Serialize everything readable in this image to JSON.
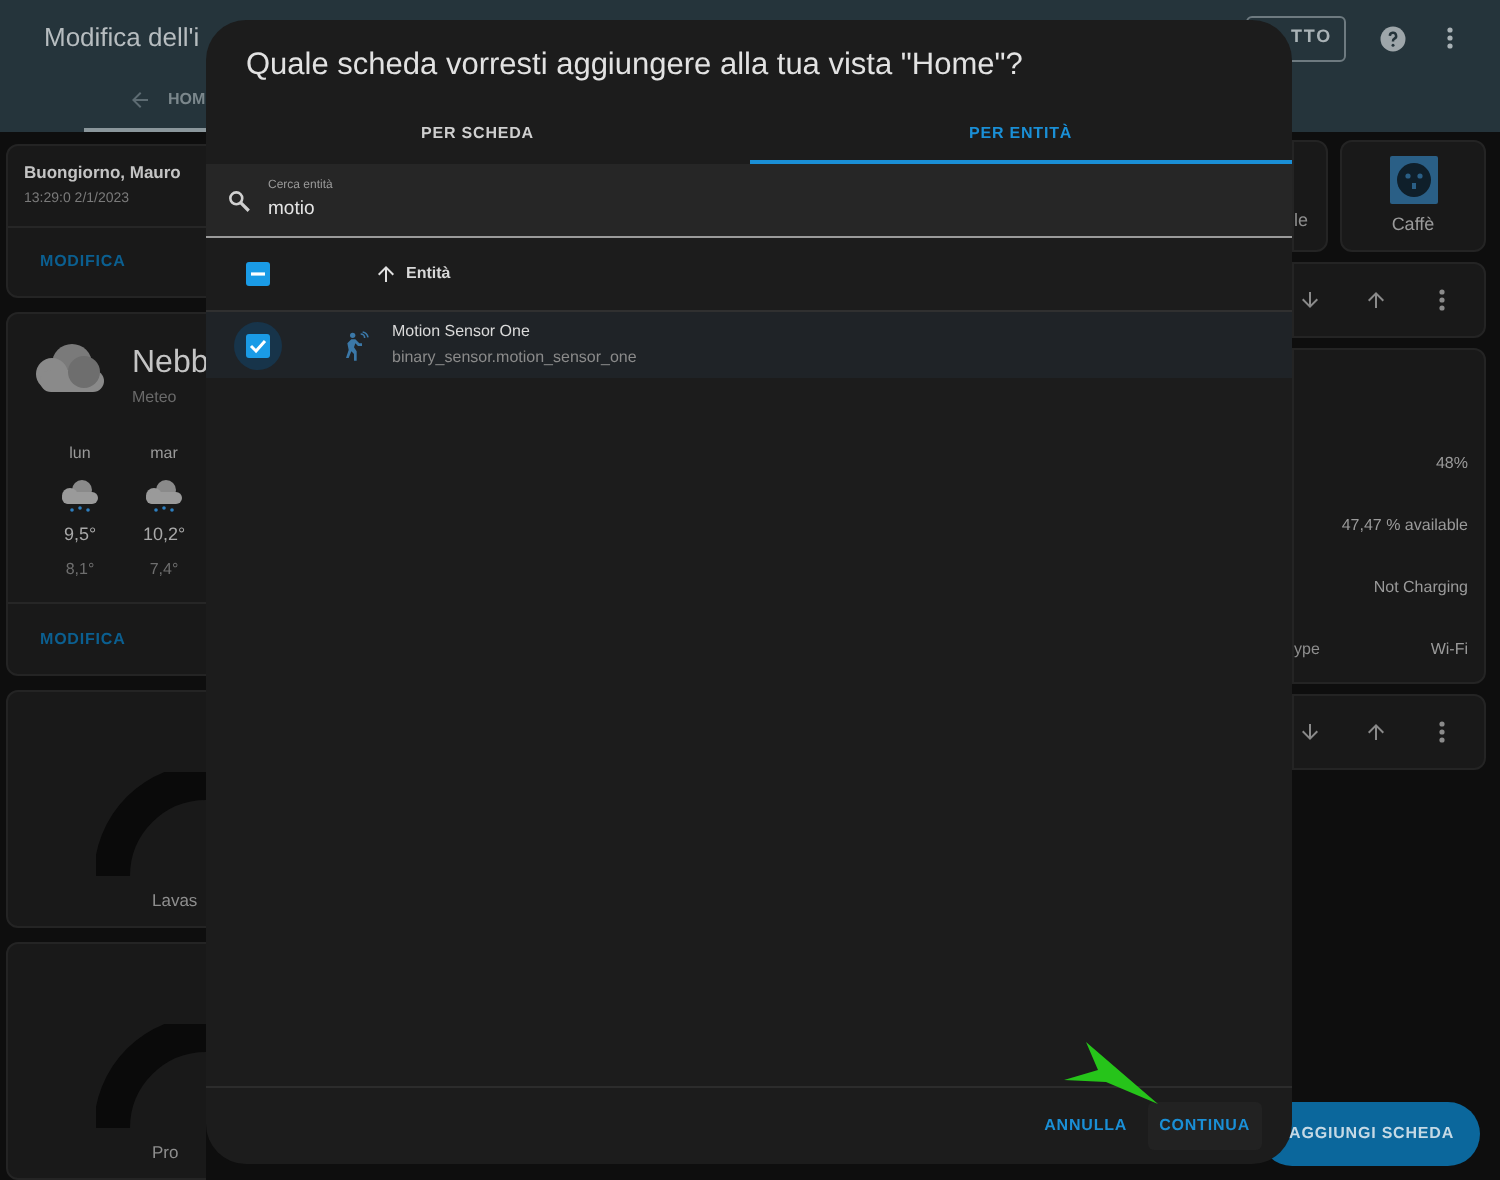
{
  "header": {
    "title": "Modifica dell'i",
    "tab": "HOM",
    "done_button": "TTO"
  },
  "left_cards": [
    {
      "kind": "greeting",
      "title": "Buongiorno, Mauro",
      "subtitle": "13:29:0 2/1/2023",
      "action": "MODIFICA"
    },
    {
      "kind": "weather",
      "state": "Nebb",
      "label": "Meteo",
      "forecast": [
        {
          "day": "lun",
          "high": "9,5°",
          "low": "8,1°"
        },
        {
          "day": "mar",
          "high": "10,2°",
          "low": "7,4°"
        }
      ],
      "action": "MODIFICA"
    },
    {
      "kind": "gauge",
      "label": "Lavas"
    },
    {
      "kind": "gauge",
      "label": "Pro"
    }
  ],
  "right_cards": [
    {
      "kind": "buttons",
      "items": [
        "le",
        "Caffè"
      ]
    },
    {
      "kind": "toolbar"
    },
    {
      "kind": "entities",
      "rows": [
        {
          "value": "48%"
        },
        {
          "value": "47,47 % available"
        },
        {
          "value": "Not Charging"
        },
        {
          "name": "ype",
          "value": "Wi-Fi"
        }
      ]
    },
    {
      "kind": "toolbar"
    }
  ],
  "fab": "AGGIUNGI SCHEDA",
  "dialog": {
    "title": "Quale scheda vorresti aggiungere alla tua vista \"Home\"?",
    "tabs": [
      {
        "label": "PER SCHEDA",
        "selected": false
      },
      {
        "label": "PER ENTITÀ",
        "selected": true
      }
    ],
    "search": {
      "label": "Cerca entità",
      "value": "motio"
    },
    "table": {
      "select_all": {
        "indeterminate": true
      },
      "sort_column": "Entità",
      "rows": [
        {
          "name": "Motion Sensor One",
          "entity_id": "binary_sensor.motion_sensor_one",
          "selected": true
        }
      ]
    },
    "buttons": [
      "ANNULLA",
      "CONTINUA"
    ]
  }
}
